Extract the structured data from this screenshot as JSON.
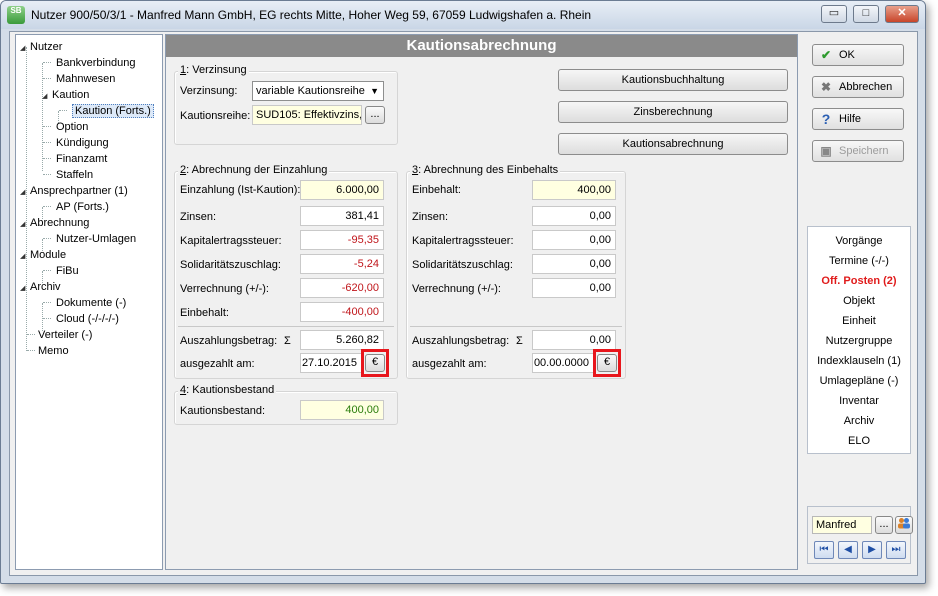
{
  "window": {
    "title": "Nutzer 900/50/3/1 - Manfred Mann GmbH, EG rechts Mitte, Hoher Weg 59, 67059 Ludwigshafen a. Rhein",
    "app_icon_text": "SB",
    "controls": {
      "minimize": "▭",
      "maximize": "□",
      "close": "✕"
    }
  },
  "tree": {
    "items": [
      {
        "label": "Nutzer",
        "level": 0,
        "expander": "◢"
      },
      {
        "label": "Bankverbindung",
        "level": 1
      },
      {
        "label": "Mahnwesen",
        "level": 1
      },
      {
        "label": "Kaution",
        "level": 1,
        "expander": "◢"
      },
      {
        "label": "Kaution (Forts.)",
        "level": 2,
        "selected": true
      },
      {
        "label": "Option",
        "level": 1
      },
      {
        "label": "Kündigung",
        "level": 1
      },
      {
        "label": "Finanzamt",
        "level": 1
      },
      {
        "label": "Staffeln",
        "level": 1
      },
      {
        "label": "Ansprechpartner (1)",
        "level": 0,
        "expander": "◢"
      },
      {
        "label": "AP (Forts.)",
        "level": 1
      },
      {
        "label": "Abrechnung",
        "level": 0,
        "expander": "◢"
      },
      {
        "label": "Nutzer-Umlagen",
        "level": 1
      },
      {
        "label": "Module",
        "level": 0,
        "expander": "◢"
      },
      {
        "label": "FiBu",
        "level": 1
      },
      {
        "label": "Archiv",
        "level": 0,
        "expander": "◢"
      },
      {
        "label": "Dokumente (-)",
        "level": 1
      },
      {
        "label": "Cloud (-/-/-/-)",
        "level": 1
      },
      {
        "label": "Verteiler (-)",
        "level": 0
      },
      {
        "label": "Memo",
        "level": 0
      }
    ]
  },
  "main": {
    "header": "Kautionsabrechnung",
    "verzinsung": {
      "title_num": "1",
      "title_rest": ": Verzinsung",
      "verzinsung_label": "Verzinsung:",
      "verzinsung_value": "variable Kautionsreihe",
      "kautionsreihe_label": "Kautionsreihe:",
      "kautionsreihe_value": "SUD105: Effektivzins,",
      "browse": "..."
    },
    "buttons": {
      "kautionsbuchhaltung": "Kautionsbuchhaltung",
      "zinsberechnung": "Zinsberechnung",
      "kautionsabrechnung": "Kautionsabrechnung"
    },
    "einzahlung": {
      "title_num": "2",
      "title_rest": ": Abrechnung der Einzahlung",
      "rows": [
        {
          "label": "Einzahlung (Ist-Kaution):",
          "value": "6.000,00",
          "style": "y"
        },
        {
          "label": "Zinsen:",
          "value": "381,41",
          "style": ""
        },
        {
          "label": "Kapitalertragssteuer:",
          "value": "-95,35",
          "style": "neg"
        },
        {
          "label": "Solidaritätszuschlag:",
          "value": "-5,24",
          "style": "neg"
        },
        {
          "label": "Verrechnung (+/-):",
          "value": "-620,00",
          "style": "neg"
        },
        {
          "label": "Einbehalt:",
          "value": "-400,00",
          "style": "neg"
        }
      ],
      "auszahlung_label": "Auszahlungsbetrag:",
      "sigma": "Σ",
      "auszahlung_value": "5.260,82",
      "ausgezahlt_label": "ausgezahlt am:",
      "ausgezahlt_value": "27.10.2015",
      "euro_button": "€"
    },
    "einbehalt": {
      "title_num": "3",
      "title_rest": ": Abrechnung des Einbehalts",
      "rows": [
        {
          "label": "Einbehalt:",
          "value": "400,00",
          "style": "y"
        },
        {
          "label": "Zinsen:",
          "value": "0,00",
          "style": ""
        },
        {
          "label": "Kapitalertragssteuer:",
          "value": "0,00",
          "style": ""
        },
        {
          "label": "Solidaritätszuschlag:",
          "value": "0,00",
          "style": ""
        },
        {
          "label": "Verrechnung (+/-):",
          "value": "0,00",
          "style": ""
        }
      ],
      "auszahlung_label": "Auszahlungsbetrag:",
      "sigma": "Σ",
      "auszahlung_value": "0,00",
      "ausgezahlt_label": "ausgezahlt am:",
      "ausgezahlt_value": "00.00.0000",
      "euro_button": "€"
    },
    "bestand": {
      "title_num": "4",
      "title_rest": ": Kautionsbestand",
      "label": "Kautionsbestand:",
      "value": "400,00"
    }
  },
  "actions": {
    "ok": {
      "label": "OK",
      "icon": "✔"
    },
    "abbrechen": {
      "label": "Abbrechen",
      "icon": "✖"
    },
    "hilfe": {
      "label": "Hilfe",
      "icon": "?"
    },
    "speichern": {
      "label": "Speichern",
      "icon": "▣"
    }
  },
  "nav": {
    "items": [
      {
        "label": "Vorgänge"
      },
      {
        "label": "Termine (-/-)"
      },
      {
        "label": "Off. Posten (2)",
        "active": true
      },
      {
        "label": "Objekt"
      },
      {
        "label": "Einheit"
      },
      {
        "label": "Nutzergruppe"
      },
      {
        "label": "Indexklauseln (1)"
      },
      {
        "label": "Umlagepläne (-)"
      },
      {
        "label": "Inventar"
      },
      {
        "label": "Archiv"
      },
      {
        "label": "ELO"
      }
    ]
  },
  "user": {
    "name": "Manfred",
    "browse": "...",
    "nav_first": "⏮",
    "nav_prev": "◀",
    "nav_next": "▶",
    "nav_last": "⏭"
  }
}
